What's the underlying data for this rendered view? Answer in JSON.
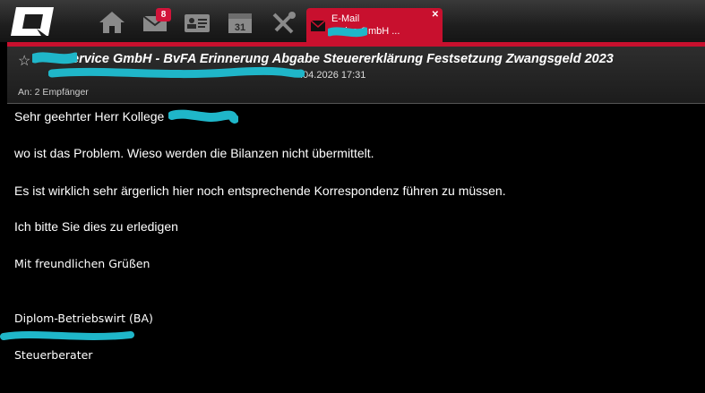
{
  "tab": {
    "type": "E-Mail",
    "title": "ervice GmbH ..."
  },
  "badge_count": "8",
  "email": {
    "subject": "ervice GmbH - BvFA Erinnerung Abgabe Steuererklärung Festsetzung Zwangsgeld 2023",
    "date": ".04.2026 17:31",
    "recipients": "An: 2 Empfänger"
  },
  "body": {
    "greeting": "Sehr geehrter Herr Kollege",
    "line1": "wo ist das Problem. Wieso werden die Bilanzen nicht übermittelt.",
    "line2": "Es ist wirklich sehr ärgerlich hier noch entsprechende Korrespondenz führen zu müssen.",
    "line3": "Ich bitte Sie dies zu erledigen",
    "closing": "Mit freundlichen Grüßen",
    "title": "Diplom-Betriebswirt (BA)",
    "role": "Steuerberater"
  },
  "icons": [
    "app-logo-icon",
    "home-icon",
    "mail-icon",
    "contacts-icon",
    "calendar-icon",
    "tools-icon",
    "envelope-icon",
    "star-icon",
    "close-icon"
  ],
  "colors": {
    "accent": "#c8102e",
    "redaction": "#1fb6c9"
  }
}
